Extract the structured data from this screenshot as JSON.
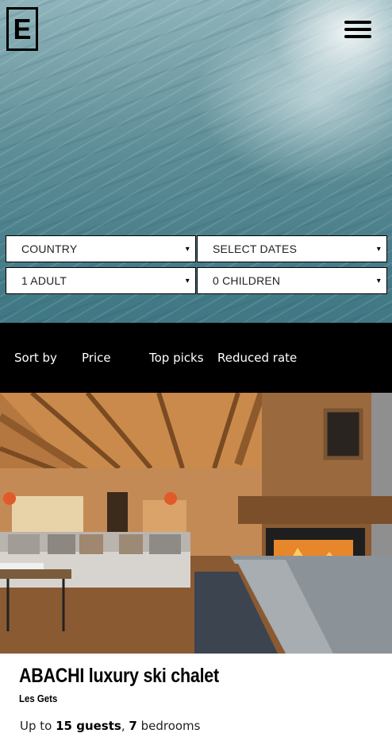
{
  "logo": {
    "letter": "E"
  },
  "search": {
    "country": "COUNTRY",
    "dates": "SELECT DATES",
    "adults": "1 ADULT",
    "children": "0 CHILDREN",
    "caret": "▾"
  },
  "sort": {
    "label": "Sort by",
    "options": [
      "Price",
      "Top picks",
      "Reduced rate"
    ]
  },
  "listing": {
    "title": "ABACHI luxury ski chalet",
    "location": "Les Gets",
    "guests_prefix": "Up to ",
    "guests_count": "15 guests",
    "separator": ", ",
    "bedrooms_count": "7",
    "bedrooms_suffix": " bedrooms"
  },
  "icons": {
    "menu": "hamburger-menu-icon",
    "dropdown": "caret-down-icon"
  }
}
